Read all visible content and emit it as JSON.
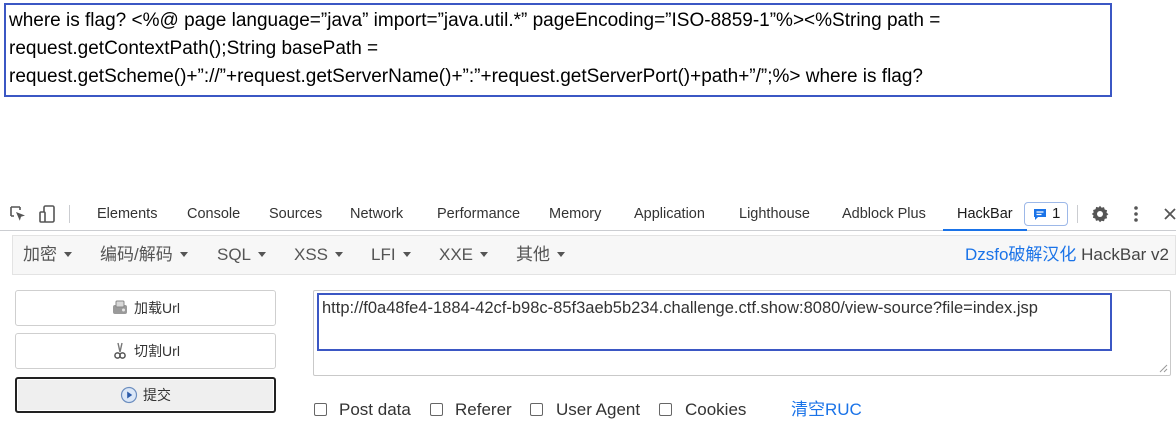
{
  "page": {
    "text": "where is flag? <%@ page language=”java” import=”java.util.*” pageEncoding=”ISO-8859-1”%><%String path = request.getContextPath();String basePath = request.getScheme()+”://”+request.getServerName()+”:”+request.getServerPort()+path+”/”;%> where is flag?"
  },
  "devtools": {
    "tabs": [
      {
        "label": "Elements"
      },
      {
        "label": "Console"
      },
      {
        "label": "Sources"
      },
      {
        "label": "Network"
      },
      {
        "label": "Performance"
      },
      {
        "label": "Memory"
      },
      {
        "label": "Application"
      },
      {
        "label": "Lighthouse"
      },
      {
        "label": "Adblock Plus"
      },
      {
        "label": "HackBar"
      }
    ],
    "active_tab": "HackBar",
    "issues_count": "1",
    "icons": {
      "inspect": "inspect-element-icon",
      "device": "device-toolbar-icon",
      "issues": "message-icon",
      "settings": "gear-icon",
      "more": "more-vertical-icon",
      "close": "close-icon"
    },
    "accent_color": "#1a73e8"
  },
  "hackbar": {
    "menu": [
      {
        "label": "加密"
      },
      {
        "label": "编码/解码"
      },
      {
        "label": "SQL"
      },
      {
        "label": "XSS"
      },
      {
        "label": "LFI"
      },
      {
        "label": "XXE"
      },
      {
        "label": "其他"
      }
    ],
    "brand_link": "Dzsfo破解汉化",
    "brand_suffix": " HackBar v2",
    "buttons": {
      "load": "加载Url",
      "split": "切割Url",
      "submit": "提交"
    },
    "url_value": "http://f0a48fe4-1884-42cf-b98c-85f3aeb5b234.challenge.ctf.show:8080/view-source?file=index.jsp",
    "options": [
      {
        "label": "Post data",
        "checked": false
      },
      {
        "label": "Referer",
        "checked": false
      },
      {
        "label": "User Agent",
        "checked": false
      },
      {
        "label": "Cookies",
        "checked": false
      }
    ],
    "clear_label": "清空RUC",
    "highlight_color": "#3b57c4"
  }
}
